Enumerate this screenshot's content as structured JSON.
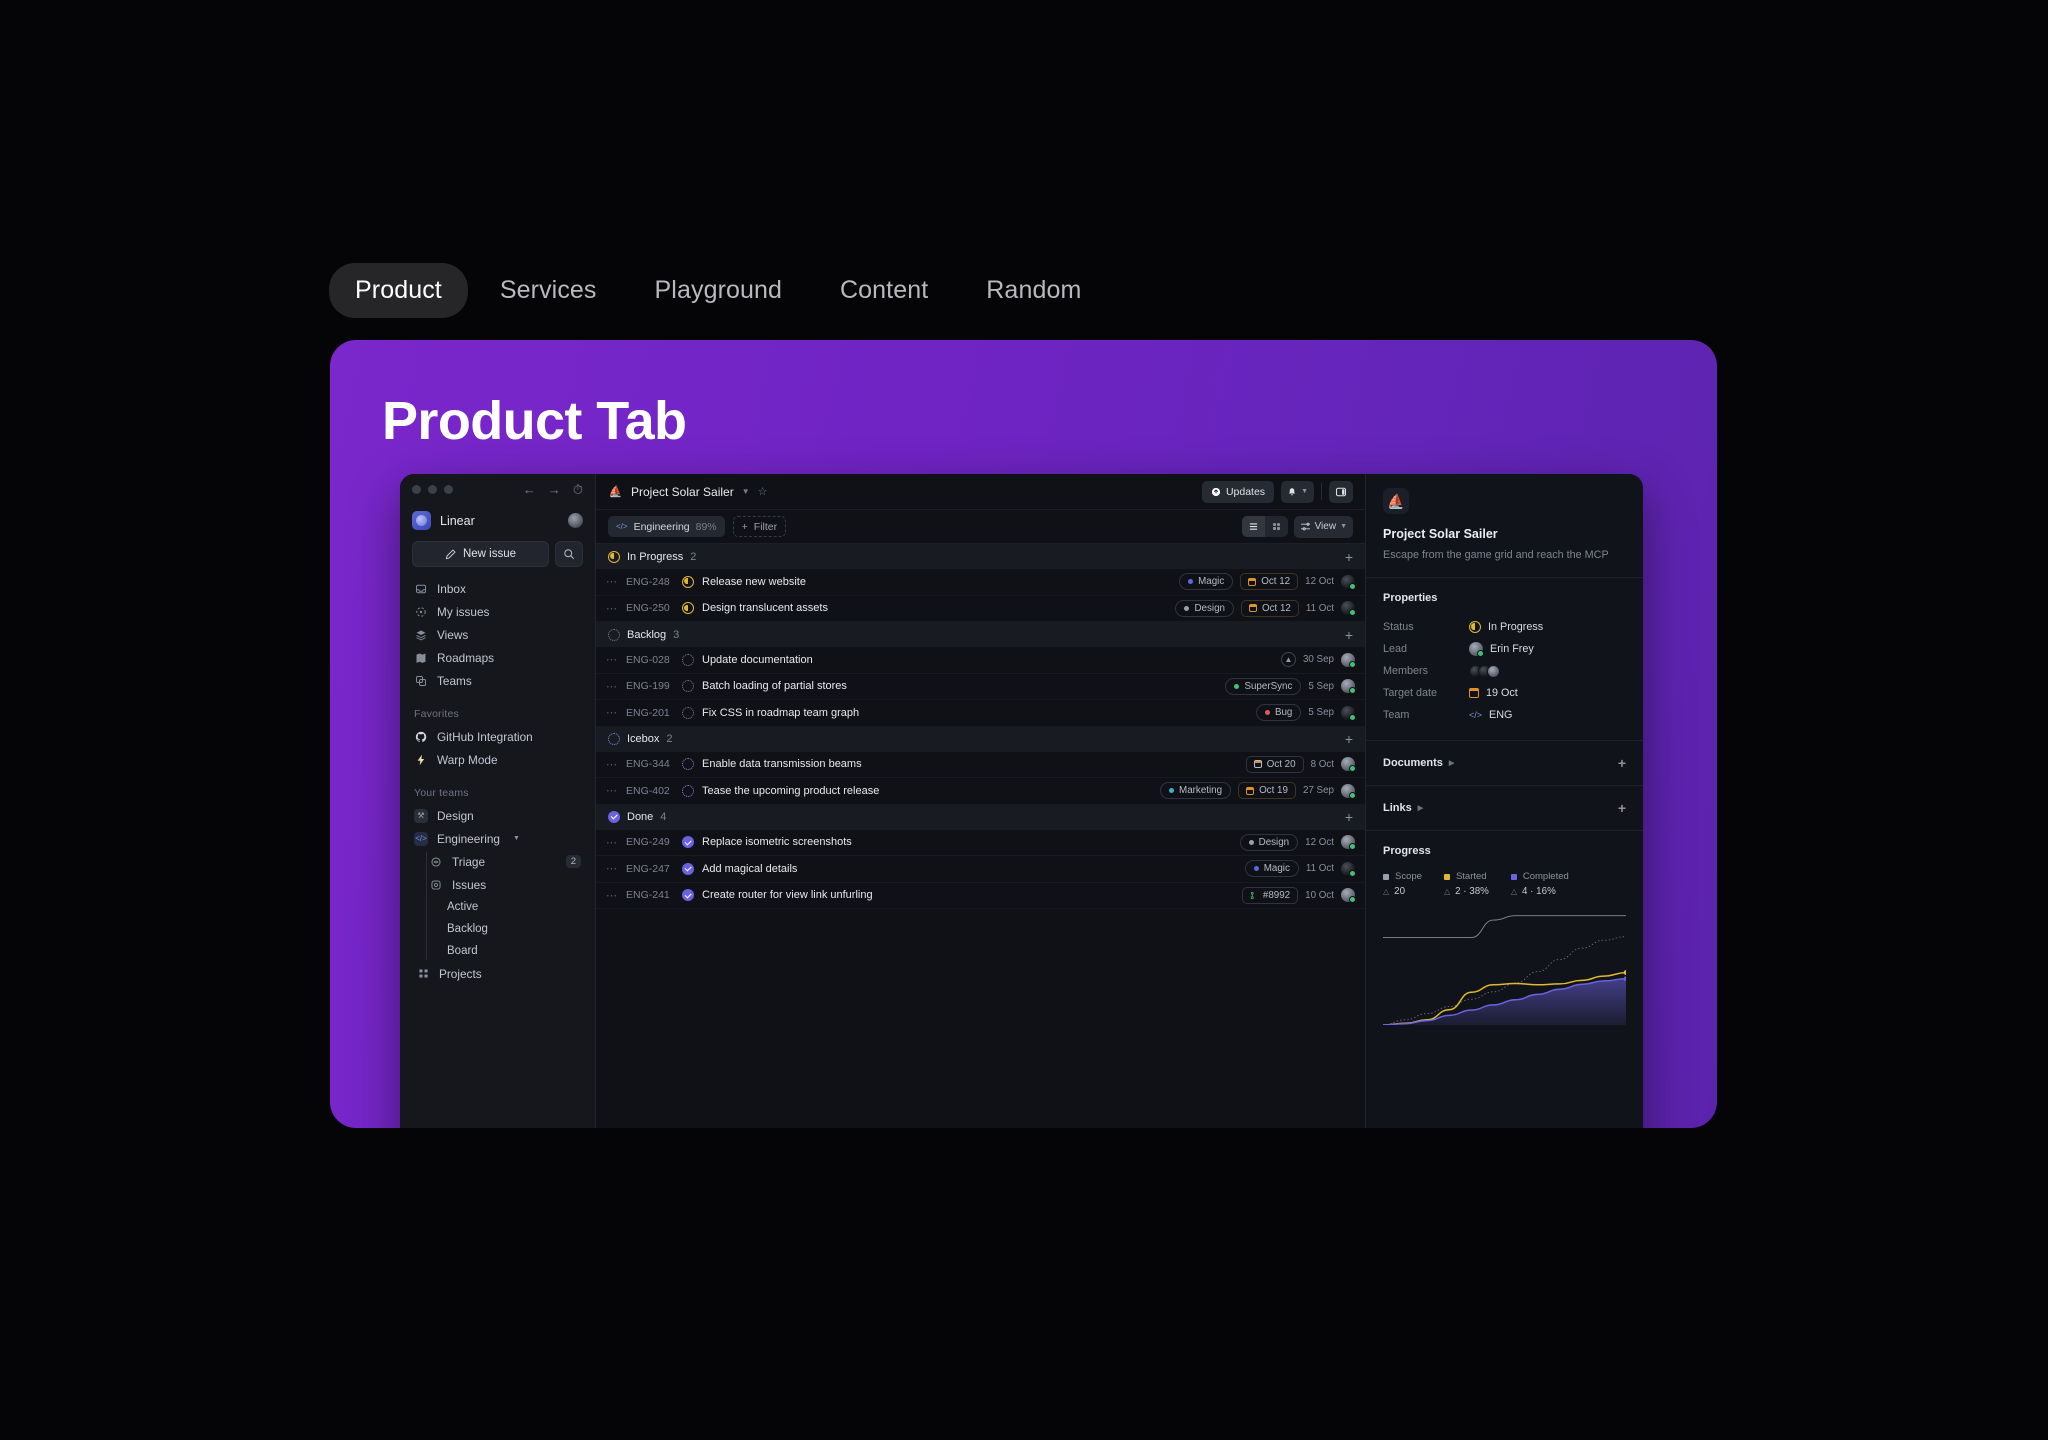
{
  "tabs": [
    {
      "label": "Product",
      "active": true
    },
    {
      "label": "Services",
      "active": false
    },
    {
      "label": "Playground",
      "active": false
    },
    {
      "label": "Content",
      "active": false
    },
    {
      "label": "Random",
      "active": false
    }
  ],
  "card": {
    "title": "Product Tab",
    "bg_from": "#7a27cc",
    "bg_to": "#5b23ad"
  },
  "sidebar": {
    "workspace": "Linear",
    "new_issue_label": "New issue",
    "nav": [
      {
        "label": "Inbox",
        "icon": "inbox-icon"
      },
      {
        "label": "My issues",
        "icon": "target-icon"
      },
      {
        "label": "Views",
        "icon": "layers-icon"
      },
      {
        "label": "Roadmaps",
        "icon": "map-icon"
      },
      {
        "label": "Teams",
        "icon": "teams-icon"
      }
    ],
    "favorites_label": "Favorites",
    "favorites": [
      {
        "label": "GitHub Integration",
        "icon": "github-icon"
      },
      {
        "label": "Warp Mode",
        "icon": "bolt-icon"
      }
    ],
    "teams_label": "Your teams",
    "teams": [
      {
        "label": "Design",
        "icon": "design-icon",
        "expanded": false
      },
      {
        "label": "Engineering",
        "icon": "code-icon",
        "expanded": true
      }
    ],
    "eng_children": [
      {
        "label": "Triage",
        "icon": "triage-icon",
        "count": "2"
      },
      {
        "label": "Issues",
        "icon": "issues-icon",
        "count": ""
      }
    ],
    "issue_views": [
      "Active",
      "Backlog",
      "Board"
    ],
    "projects_label": "Projects"
  },
  "topbar": {
    "project": "Project Solar Sailer",
    "updates_label": "Updates",
    "icons": [
      "boat-icon",
      "chevron-down-icon",
      "star-icon",
      "bell-icon",
      "panel-icon"
    ]
  },
  "filterbar": {
    "team_chip": "Engineering",
    "team_pct": "89%",
    "filter_label": "Filter",
    "view_label": "View"
  },
  "groups": [
    {
      "name": "In Progress",
      "count": "2",
      "status": "progress",
      "rows": [
        {
          "id": "ENG-248",
          "title": "Release new website",
          "status": "progress",
          "tag": "Magic",
          "tag_color": "#5b6ae0",
          "date": "Oct 12",
          "when": "12 Oct",
          "avatar": "dark"
        },
        {
          "id": "ENG-250",
          "title": "Design translucent assets",
          "status": "progress",
          "tag": "Design",
          "tag_color": "#9aa0ab",
          "date": "Oct 12",
          "when": "11 Oct",
          "avatar": "dark"
        }
      ]
    },
    {
      "name": "Backlog",
      "count": "3",
      "status": "backlog",
      "rows": [
        {
          "id": "ENG-028",
          "title": "Update documentation",
          "status": "backlog",
          "warn": true,
          "when": "30 Sep",
          "avatar": "light"
        },
        {
          "id": "ENG-199",
          "title": "Batch loading of partial stores",
          "status": "backlog",
          "tag": "SuperSync",
          "tag_color": "#3ec17a",
          "when": "5 Sep",
          "avatar": "light"
        },
        {
          "id": "ENG-201",
          "title": "Fix CSS in roadmap team graph",
          "status": "backlog",
          "tag": "Bug",
          "tag_color": "#e05b5b",
          "when": "5 Sep",
          "avatar": "dark"
        }
      ]
    },
    {
      "name": "Icebox",
      "count": "2",
      "status": "icebox",
      "rows": [
        {
          "id": "ENG-344",
          "title": "Enable data transmission beams",
          "status": "icebox",
          "date": "Oct 20",
          "date_plain": true,
          "when": "8 Oct",
          "avatar": "light"
        },
        {
          "id": "ENG-402",
          "title": "Tease the upcoming product release",
          "status": "icebox",
          "tag": "Marketing",
          "tag_color": "#36b6c4",
          "date": "Oct 19",
          "when": "27 Sep",
          "avatar": "light"
        }
      ]
    },
    {
      "name": "Done",
      "count": "4",
      "status": "done",
      "rows": [
        {
          "id": "ENG-249",
          "title": "Replace isometric screenshots",
          "status": "done",
          "tag": "Design",
          "tag_color": "#9aa0ab",
          "when": "12 Oct",
          "avatar": "light"
        },
        {
          "id": "ENG-247",
          "title": "Add magical details",
          "status": "done",
          "tag": "Magic",
          "tag_color": "#5b6ae0",
          "when": "11 Oct",
          "avatar": "dark"
        },
        {
          "id": "ENG-241",
          "title": "Create router for view link unfurling",
          "status": "done",
          "gh": "#8992",
          "when": "10 Oct",
          "avatar": "light"
        }
      ]
    }
  ],
  "detail": {
    "title": "Project Solar Sailer",
    "description": "Escape from the game grid and reach the MCP",
    "properties_label": "Properties",
    "properties": [
      {
        "label": "Status",
        "value": "In Progress",
        "kind": "status"
      },
      {
        "label": "Lead",
        "value": "Erin Frey",
        "kind": "avatar"
      },
      {
        "label": "Members",
        "value": "",
        "kind": "members"
      },
      {
        "label": "Target date",
        "value": "19 Oct",
        "kind": "date"
      },
      {
        "label": "Team",
        "value": "ENG",
        "kind": "team"
      }
    ],
    "documents_label": "Documents",
    "links_label": "Links",
    "progress_label": "Progress"
  },
  "chart_data": {
    "type": "area",
    "title": "Progress",
    "legend_position": "top",
    "series": [
      {
        "name": "Scope",
        "color": "#9aa0ab",
        "delta": "20",
        "values": [
          20,
          20,
          20,
          20,
          20,
          24,
          25,
          25,
          25,
          25,
          25,
          25
        ]
      },
      {
        "name": "Started",
        "color": "#e0b92f",
        "delta": "2 · 38%",
        "values": [
          0,
          0.4,
          1.2,
          3.5,
          7.5,
          9.2,
          9.5,
          9.2,
          9.4,
          10.2,
          11.2,
          12.0
        ]
      },
      {
        "name": "Completed",
        "color": "#6b62e0",
        "delta": "4 · 16%",
        "values": [
          0,
          0.3,
          1.0,
          2.2,
          3.4,
          4.6,
          5.8,
          7.0,
          8.2,
          9.3,
          10.1,
          10.6
        ]
      },
      {
        "name": "Projection",
        "color": "#8d929d",
        "dashed": true,
        "values": [
          0,
          1.2,
          2.6,
          4.2,
          5.9,
          7.6,
          9.6,
          12.2,
          15.0,
          17.6,
          19.4,
          20.2
        ]
      }
    ],
    "ylim": [
      0,
      27
    ],
    "grid": false
  }
}
